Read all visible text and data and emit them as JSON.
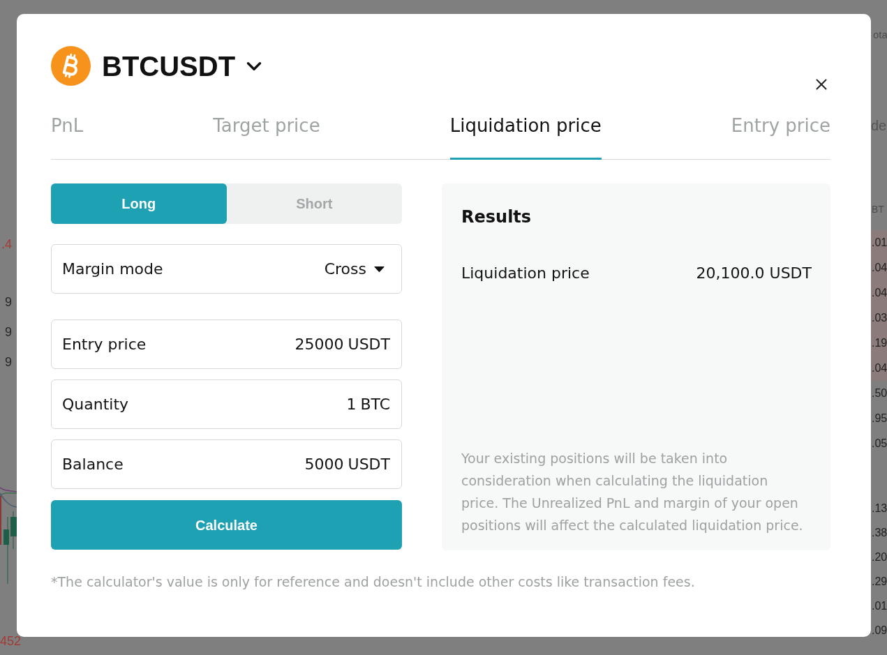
{
  "background_page": {
    "left_edge_texts": [
      {
        "text": ".4",
        "color": "#a33b36"
      },
      {
        "text": "9",
        "color": "#262626"
      },
      {
        "text": "9",
        "color": "#262626"
      },
      {
        "text": "9",
        "color": "#262626"
      }
    ],
    "left_edge_bottom_text": "452",
    "right_edge_header": "ota",
    "right_edge_tab": "de",
    "right_edge_column_heading": "BT",
    "right_edge_upper_rows": [
      {
        "text": ".01",
        "shaded": true
      },
      {
        "text": ".04",
        "shaded": true
      },
      {
        "text": ".04",
        "shaded": true
      },
      {
        "text": ".03",
        "shaded": true
      },
      {
        "text": ".19",
        "shaded": true
      },
      {
        "text": ".04",
        "shaded": true
      },
      {
        "text": ".50",
        "shaded": false
      },
      {
        "text": ".95",
        "shaded": false
      },
      {
        "text": ".05",
        "shaded": false
      }
    ],
    "right_edge_lower_rows": [
      {
        "text": ".13",
        "shaded": false
      },
      {
        "text": ".38",
        "shaded": false
      },
      {
        "text": ".20",
        "shaded": false
      },
      {
        "text": ".29",
        "shaded": false
      },
      {
        "text": ".01",
        "shaded": false
      },
      {
        "text": ".09",
        "shaded": false
      }
    ]
  },
  "dialog": {
    "symbol": "BTCUSDT",
    "tabs": [
      {
        "label": "PnL",
        "selected": false
      },
      {
        "label": "Target price",
        "selected": false
      },
      {
        "label": "Liquidation price",
        "selected": true
      },
      {
        "label": "Entry price",
        "selected": false
      }
    ],
    "side_toggle": [
      {
        "label": "Long",
        "selected": true
      },
      {
        "label": "Short",
        "selected": false
      }
    ],
    "margin_mode": {
      "label": "Margin mode",
      "value": "Cross"
    },
    "inputs": [
      {
        "label": "Entry price",
        "value": "25000",
        "unit": "USDT"
      },
      {
        "label": "Quantity",
        "value": "1",
        "unit": "BTC"
      },
      {
        "label": "Balance",
        "value": "5000",
        "unit": "USDT"
      }
    ],
    "calculate_button": "Calculate",
    "results": {
      "title": "Results",
      "rows": [
        {
          "label": "Liquidation price",
          "value": "20,100.0 USDT"
        }
      ],
      "note": "Your existing positions will be taken into consideration when calculating the liquidation price. The Unrealized PnL and margin of your open positions will affect the calculated liquidation price."
    },
    "footnote": "*The calculator's value is only for reference and doesn't include other costs like transaction fees."
  }
}
